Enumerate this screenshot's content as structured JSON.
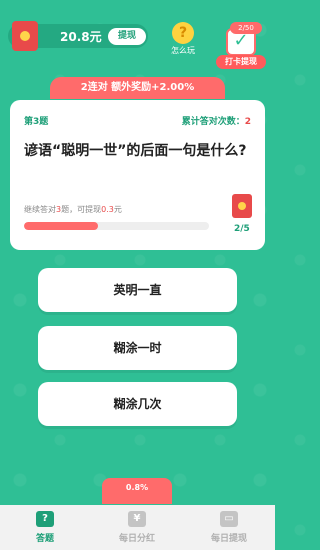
{
  "top": {
    "balance": "20.8元",
    "withdraw_label": "提现",
    "how_to_label": "怎么玩",
    "how_to_icon": "question-icon",
    "checkin_progress": "2/50",
    "checkin_label": "打卡提现"
  },
  "streak_banner": "2连对 额外奖励+2.00%",
  "question": {
    "number": "第3题",
    "cumulative_label": "累计答对次数：",
    "cumulative_value": "2",
    "text": "谚语“聪明一世”的后面一句是什么?",
    "hint_prefix": "继续答对",
    "hint_count": "3",
    "hint_mid": "题，可提现",
    "hint_amount": "0.3",
    "hint_suffix": "元",
    "progress_fraction": 0.4,
    "redpack_progress": "2/5"
  },
  "answers": [
    "英明一直",
    "糊涂一时",
    "糊涂几次"
  ],
  "bottom": {
    "bonus": "0.8%",
    "nav": [
      {
        "label": "答题",
        "icon": "question-icon",
        "active": true
      },
      {
        "label": "每日分红",
        "icon": "money-bag-icon",
        "active": false
      },
      {
        "label": "每日提现",
        "icon": "wallet-icon",
        "active": false
      }
    ]
  },
  "colors": {
    "background": "#2fbf95",
    "accent_red": "#ff6b6b",
    "accent_green": "#1e9f78",
    "nav_active": "#1e9f78",
    "nav_inactive": "#b0b0b0"
  }
}
